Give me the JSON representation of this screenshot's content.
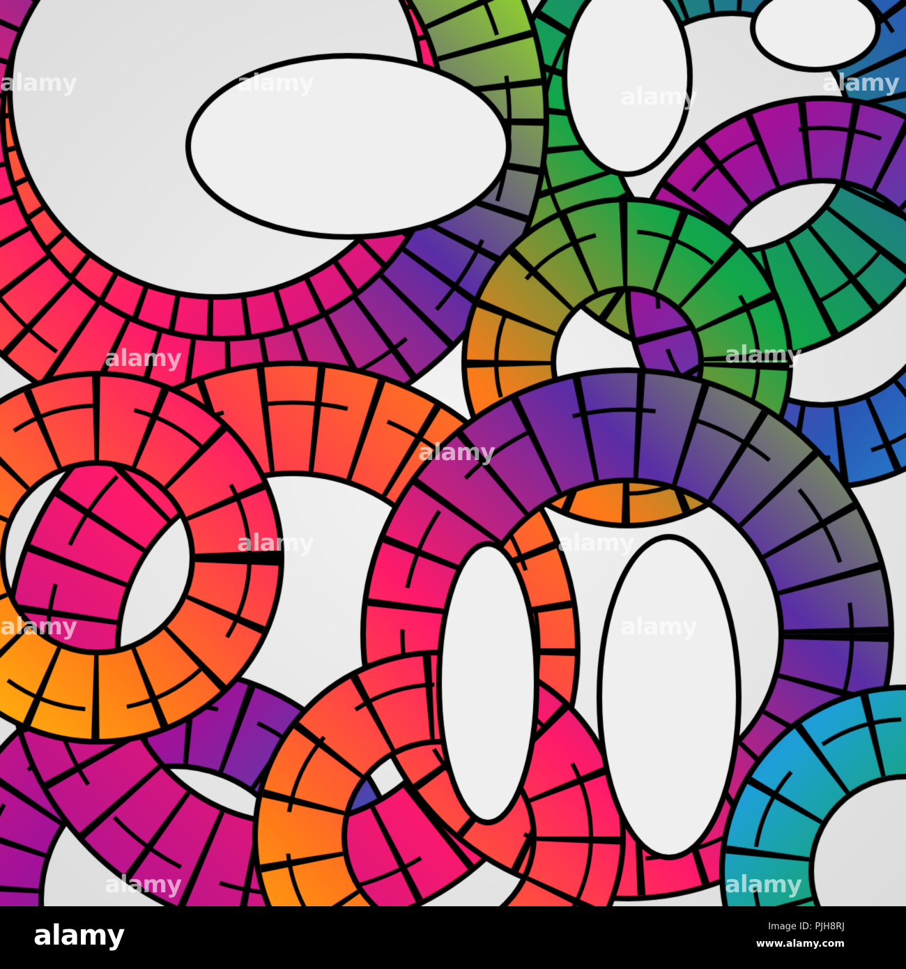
{
  "artwork": {
    "subject": "abstract colourful rings",
    "colors": [
      "#ff1a6b",
      "#a0129a",
      "#5a2ea6",
      "#2a5ab8",
      "#1fa0d8",
      "#12a84a",
      "#8fd62a",
      "#ffe000",
      "#ff7a1a",
      "#f0f0f0",
      "#000000"
    ]
  },
  "watermark": "alamy",
  "footer": {
    "logo": "alamy",
    "image_id": "Image ID: PJH8RJ",
    "url": "www.alamy.com"
  }
}
